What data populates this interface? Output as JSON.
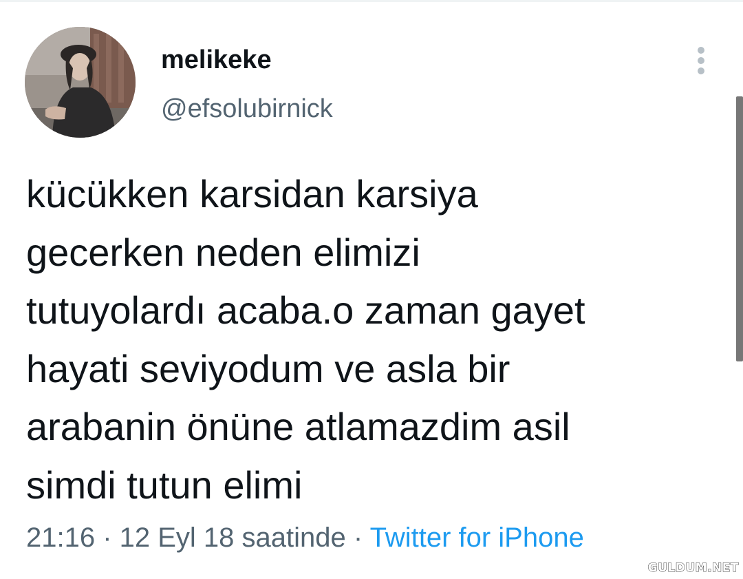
{
  "tweet": {
    "author": {
      "display_name": "melikeke",
      "handle": "@efsolubirnick"
    },
    "text_lines": [
      "kücükken karsidan karsiya",
      "gecerken neden elimizi",
      "tutuyolardı acaba.o zaman gayet",
      "hayati seviyodum ve asla bir",
      "arabanin önüne atlamazdim asil",
      "simdi tutun elimi"
    ],
    "timestamp": "21:16 · 12 Eyl 18 saatinde",
    "separator": " · ",
    "source": "Twitter for iPhone"
  },
  "icons": {
    "more": "more-vertical-icon"
  },
  "colors": {
    "primary_text": "#0f1419",
    "secondary_text": "#536471",
    "link": "#1d9bf0",
    "more_dots": "#b7c0c7"
  },
  "watermark": "GULDUM.NET"
}
